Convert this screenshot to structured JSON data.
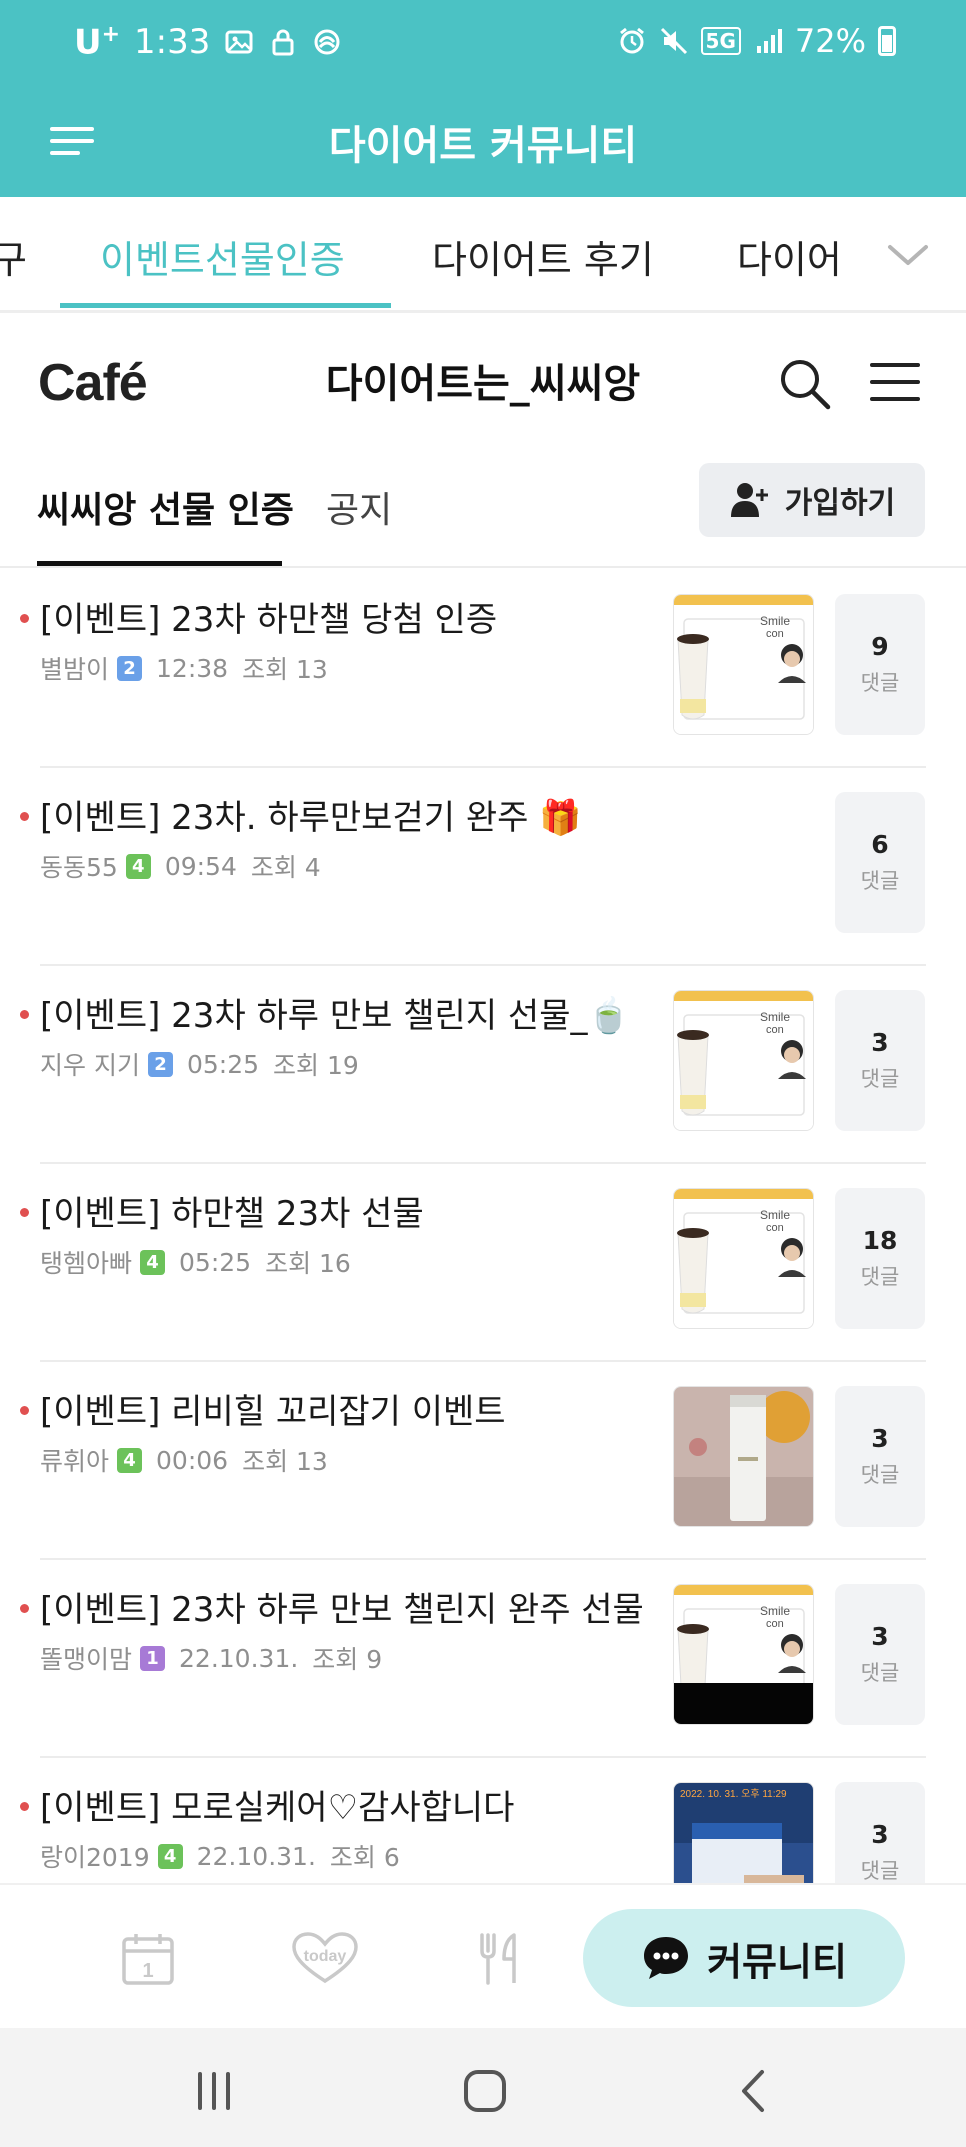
{
  "status_bar": {
    "carrier": "U",
    "carrier_sup": "+",
    "time": "1:33",
    "network": "5G",
    "battery": "72%"
  },
  "app_bar": {
    "title": "다이어트 커뮤니티"
  },
  "board_tabs": {
    "items": [
      {
        "label": "구",
        "active": false
      },
      {
        "label": "이벤트선물인증",
        "active": true
      },
      {
        "label": "다이어트 후기",
        "active": false
      },
      {
        "label": "다이어",
        "active": false
      }
    ]
  },
  "cafe": {
    "logo": "Café",
    "name": "다이어트는_씨씨앙"
  },
  "sub_tabs": {
    "items": [
      {
        "label": "씨씨앙 선물 인증",
        "active": true
      },
      {
        "label": "공지",
        "active": false
      }
    ],
    "join_label": "가입하기"
  },
  "posts": [
    {
      "title": "[이벤트] 23차 하만챌 당첨 인증",
      "author": "별밤이",
      "level": "2",
      "level_color": "#6aa0e8",
      "time": "12:38",
      "views": "조회 13",
      "comments": "9",
      "comment_label": "댓글",
      "thumb": "coupon"
    },
    {
      "title": "[이벤트] 23차. 하루만보걷기 완주 🎁",
      "author": "동동55",
      "level": "4",
      "level_color": "#6cc25a",
      "time": "09:54",
      "views": "조회 4",
      "comments": "6",
      "comment_label": "댓글",
      "thumb": "none"
    },
    {
      "title": "[이벤트] 23차 하루 만보 챌린지 선물_🍵",
      "author": "지우 지기",
      "level": "2",
      "level_color": "#6aa0e8",
      "time": "05:25",
      "views": "조회 19",
      "comments": "3",
      "comment_label": "댓글",
      "thumb": "coupon"
    },
    {
      "title": "[이벤트] 하만챌 23차 선물",
      "author": "탱헴아빠",
      "level": "4",
      "level_color": "#6cc25a",
      "time": "05:25",
      "views": "조회 16",
      "comments": "18",
      "comment_label": "댓글",
      "thumb": "coupon"
    },
    {
      "title": "[이벤트] 리비힐 꼬리잡기 이벤트",
      "author": "류휘아",
      "level": "4",
      "level_color": "#6cc25a",
      "time": "00:06",
      "views": "조회 13",
      "comments": "3",
      "comment_label": "댓글",
      "thumb": "photo"
    },
    {
      "title": "[이벤트] 23차 하루 만보 챌린지 완주 선물",
      "author": "똘맹이맘",
      "level": "1",
      "level_color": "#a77ad6",
      "time": "22.10.31.",
      "views": "조회 9",
      "comments": "3",
      "comment_label": "댓글",
      "thumb": "coupon-dark"
    },
    {
      "title": "[이벤트] 모로실케어♡감사합니다",
      "author": "랑이2019",
      "level": "4",
      "level_color": "#6cc25a",
      "time": "22.10.31.",
      "views": "조회 6",
      "comments": "3",
      "comment_label": "댓글",
      "thumb": "box"
    }
  ],
  "thumb_texts": {
    "smile": "Smile",
    "con": "con",
    "photo_stamp": "2022. 10. 31. 오후 11:29"
  },
  "bottom_nav": {
    "items": [
      {
        "name": "calendar-icon",
        "label": "1"
      },
      {
        "name": "today-icon",
        "label": "today"
      },
      {
        "name": "food-icon",
        "label": ""
      }
    ],
    "community_label": "커뮤니티"
  },
  "colors": {
    "brand_teal": "#4bc2c4",
    "community_bg": "#ccefef",
    "new_dot": "#e05050"
  }
}
